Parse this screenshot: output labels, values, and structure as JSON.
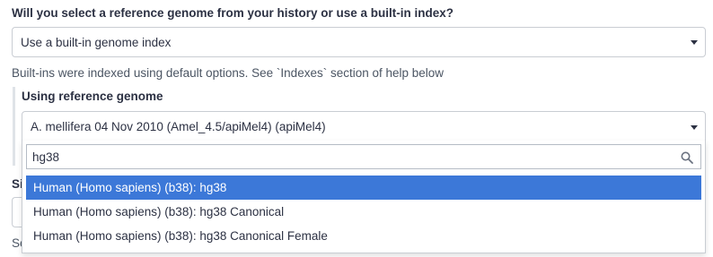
{
  "question": {
    "label": "Will you select a reference genome from your history or use a built-in index?",
    "selected": "Use a built-in genome index"
  },
  "help_text": "Built-ins were indexed using default options. See `Indexes` section of help below",
  "genome": {
    "label": "Using reference genome",
    "selected": "A. mellifera 04 Nov 2010 (Amel_4.5/apiMel4) (apiMel4)",
    "search_value": "hg38",
    "options": [
      "Human (Homo sapiens) (b38): hg38",
      "Human (Homo sapiens) (b38): hg38 Canonical",
      "Human (Homo sapiens) (b38): hg38 Canonical Female"
    ],
    "highlighted_index": 0
  },
  "obscured": {
    "label_fragment": "Si",
    "text_fragment": "Se"
  },
  "colors": {
    "highlight": "#3c78d8",
    "border": "#c9cdd3",
    "text": "#2c3143"
  },
  "icons": {
    "dropdown": "caret-down-icon",
    "search": "search-icon"
  }
}
